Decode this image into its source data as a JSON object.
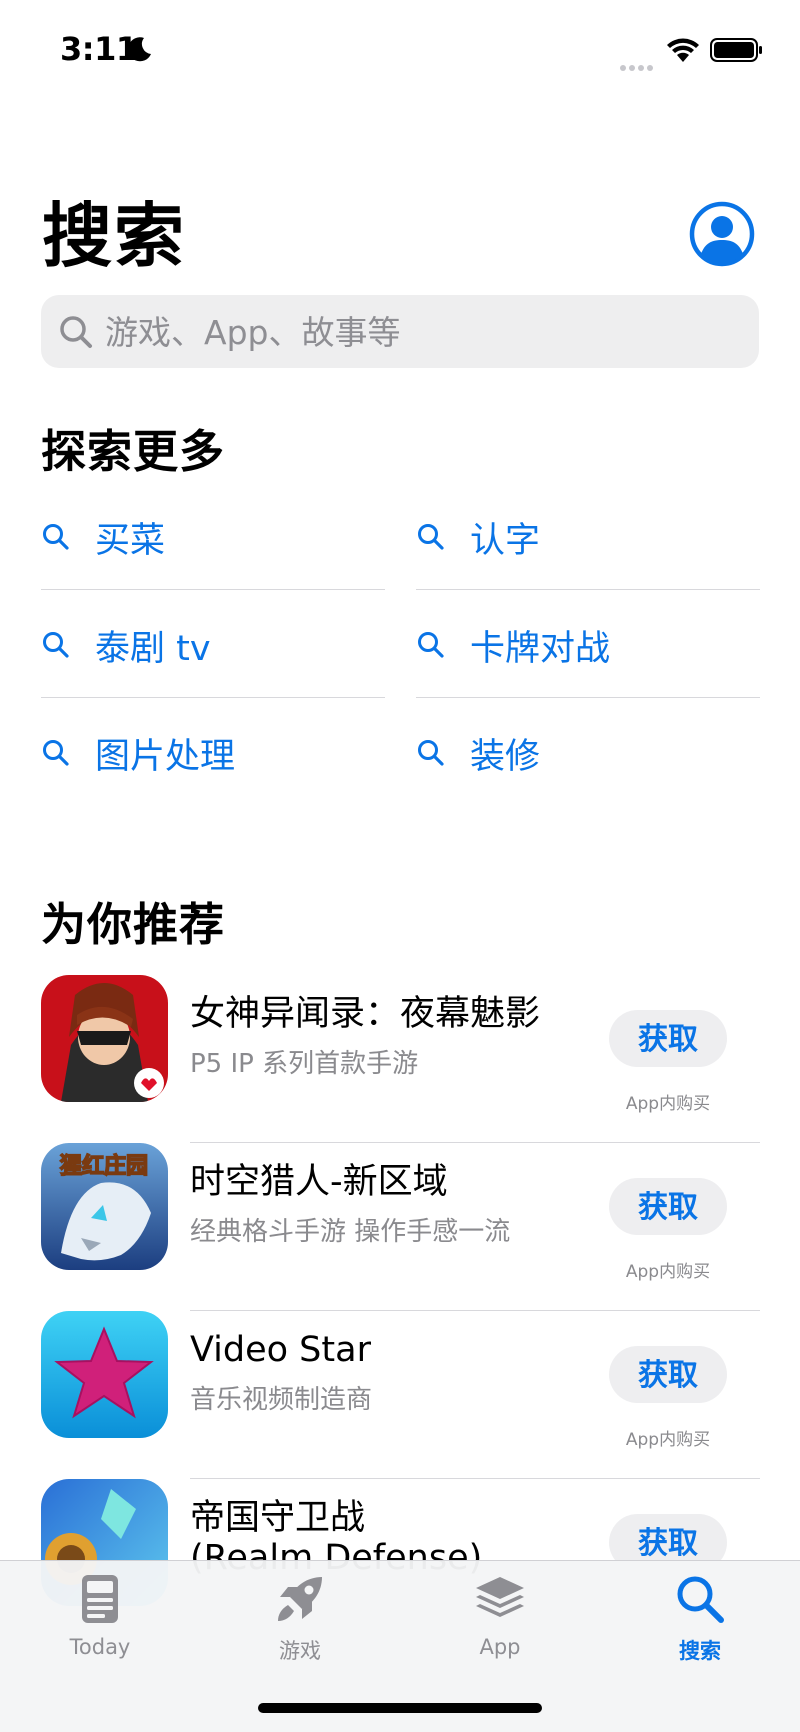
{
  "status_bar": {
    "time": "3:11"
  },
  "header": {
    "title": "搜索"
  },
  "search": {
    "placeholder": "游戏、App、故事等"
  },
  "explore": {
    "title": "探索更多",
    "items": [
      {
        "label": "买菜"
      },
      {
        "label": "认字"
      },
      {
        "label": "泰剧 tv"
      },
      {
        "label": "卡牌对战"
      },
      {
        "label": "图片处理"
      },
      {
        "label": "装修"
      }
    ]
  },
  "recommend": {
    "title": "为你推荐",
    "apps": [
      {
        "name": "女神异闻录：夜幕魅影",
        "subtitle": "P5 IP 系列首款手游",
        "button": "获取",
        "iap": "App内购买"
      },
      {
        "name": "时空猎人-新区域",
        "subtitle": "经典格斗手游 操作手感一流",
        "button": "获取",
        "iap": "App内购买",
        "icon_text": "猩红庄园"
      },
      {
        "name": "Video Star",
        "subtitle": "音乐视频制造商",
        "button": "获取",
        "iap": "App内购买"
      },
      {
        "name": "帝国守卫战",
        "name_line2": "(Realm Defense)",
        "button": "获取"
      }
    ]
  },
  "tab_bar": {
    "tabs": [
      {
        "label": "Today",
        "icon": "today-icon"
      },
      {
        "label": "游戏",
        "icon": "rocket-icon"
      },
      {
        "label": "App",
        "icon": "layers-icon"
      },
      {
        "label": "搜索",
        "icon": "search-icon",
        "active": true
      }
    ]
  },
  "colors": {
    "accent": "#0a74e6",
    "search_bg": "#eeeeef",
    "secondary_text": "#8a8a8e"
  }
}
